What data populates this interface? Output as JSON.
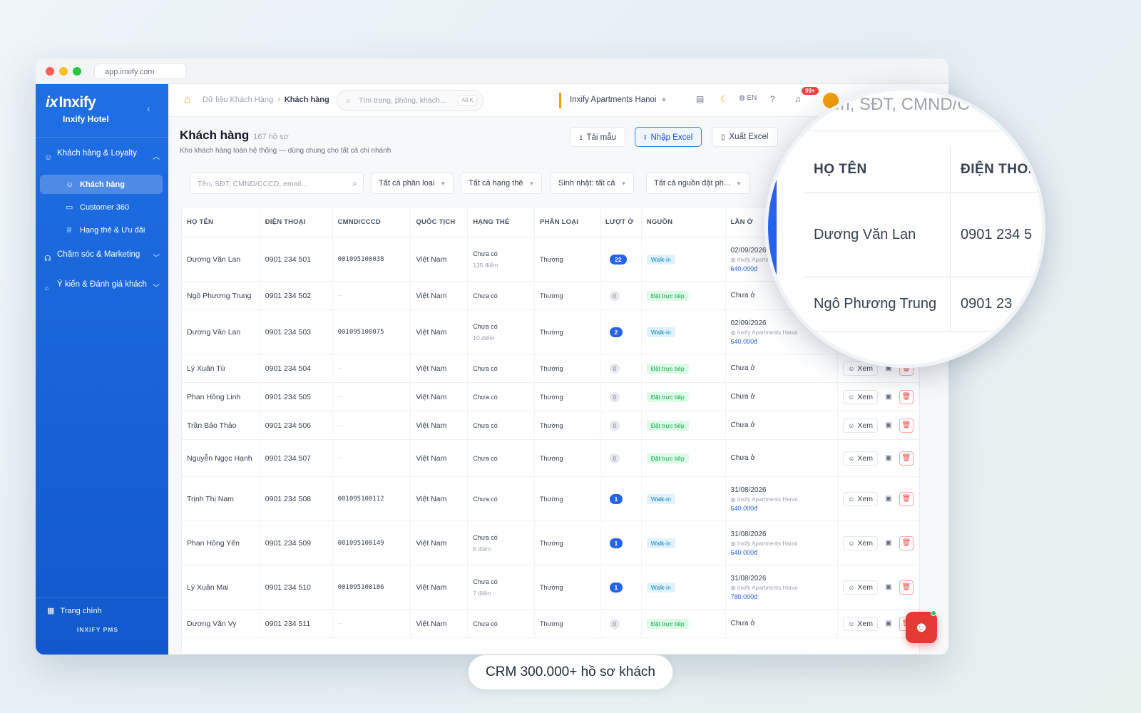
{
  "browser": {
    "url": "app.inxify.com"
  },
  "sidebar": {
    "logo": "Inxify",
    "logo_mark": "ix",
    "hotel": "Inxify Hotel",
    "groups": [
      {
        "label": "Khách hàng & Loyalty",
        "icon": "users-icon",
        "expanded": true
      },
      {
        "label": "Chăm sóc & Marketing",
        "icon": "headset-icon",
        "expanded": false
      },
      {
        "label": "Ý kiến & Đánh giá khách",
        "icon": "chat-icon",
        "expanded": false
      }
    ],
    "items": [
      {
        "label": "Khách hàng",
        "icon": "user-icon",
        "active": true
      },
      {
        "label": "Customer 360",
        "icon": "chart-icon",
        "active": false
      },
      {
        "label": "Hạng thẻ & Ưu đãi",
        "icon": "trophy-icon",
        "active": false
      }
    ],
    "home": "Trang chính",
    "footer": "INXIFY PMS"
  },
  "topbar": {
    "breadcrumb": [
      "Dữ liệu Khách Hàng",
      "Khách hàng"
    ],
    "search_placeholder": "Tìm trang, phòng, khách...",
    "search_shortcut": "Alt K",
    "branch": "Inxify Apartments Hanoi",
    "lang": "EN",
    "notifications": "99+"
  },
  "page": {
    "title": "Khách hàng",
    "count": "167 hồ sơ",
    "subtitle": "Kho khách hàng toàn hệ thống — dùng chung cho tất cả chi nhánh",
    "buttons": {
      "template": "Tải mẫu",
      "import": "Nhập Excel",
      "export": "Xuất Excel"
    }
  },
  "filters": {
    "search_placeholder": "Tên, SĐT, CMND/CCCD, email...",
    "classification": "Tất cả phân loại",
    "tier": "Tất cả hạng thẻ",
    "birthday": "Sinh nhật: tất cả",
    "source": "Tất cả nguồn đặt ph..."
  },
  "table": {
    "columns": [
      "HỌ TÊN",
      "ĐIỆN THOẠI",
      "CMND/CCCD",
      "QUỐC TỊCH",
      "HẠNG THẺ",
      "PHÂN LOẠI",
      "LƯỢT Ở",
      "NGUỒN",
      "LẦN Ở",
      ""
    ],
    "view_label": "Xem",
    "rows": [
      {
        "name": "Dương Văn Lan",
        "phone": "0901 234 501",
        "id": "001095100038",
        "nation": "Việt Nam",
        "tier": "Chưa có",
        "points": "135 điểm",
        "cls": "Thường",
        "stays": "22",
        "source": "Walk-in",
        "last_date": "02/09/2026",
        "last_hotel": "Inxify Apartments Hanoi",
        "last_price": "640.000đ"
      },
      {
        "name": "Ngô Phương Trung",
        "phone": "0901 234 502",
        "id": "—",
        "nation": "Việt Nam",
        "tier": "Chưa có",
        "points": "",
        "cls": "Thường",
        "stays": "0",
        "source": "Đặt trực tiếp",
        "last_date": "Chưa ở",
        "last_hotel": "",
        "last_price": ""
      },
      {
        "name": "Dương Văn Lan",
        "phone": "0901 234 503",
        "id": "001095100075",
        "nation": "Việt Nam",
        "tier": "Chưa có",
        "points": "10 điểm",
        "cls": "Thường",
        "stays": "2",
        "source": "Walk-in",
        "last_date": "02/09/2026",
        "last_hotel": "Inxify Apartments Hanoi",
        "last_price": "640.000đ"
      },
      {
        "name": "Lý Xuân Tú",
        "phone": "0901 234 504",
        "id": "—",
        "nation": "Việt Nam",
        "tier": "Chưa có",
        "points": "",
        "cls": "Thường",
        "stays": "0",
        "source": "Đặt trực tiếp",
        "last_date": "Chưa ở",
        "last_hotel": "",
        "last_price": ""
      },
      {
        "name": "Phan Hồng Linh",
        "phone": "0901 234 505",
        "id": "—",
        "nation": "Việt Nam",
        "tier": "Chưa có",
        "points": "",
        "cls": "Thường",
        "stays": "0",
        "source": "Đặt trực tiếp",
        "last_date": "Chưa ở",
        "last_hotel": "",
        "last_price": ""
      },
      {
        "name": "Trần Bảo Thảo",
        "phone": "0901 234 506",
        "id": "—",
        "nation": "Việt Nam",
        "tier": "Chưa có",
        "points": "",
        "cls": "Thường",
        "stays": "0",
        "source": "Đặt trực tiếp",
        "last_date": "Chưa ở",
        "last_hotel": "",
        "last_price": ""
      },
      {
        "name": "Nguyễn Ngọc Hạnh",
        "phone": "0901 234 507",
        "id": "—",
        "nation": "Việt Nam",
        "tier": "Chưa có",
        "points": "",
        "cls": "Thường",
        "stays": "0",
        "source": "Đặt trực tiếp",
        "last_date": "Chưa ở",
        "last_hotel": "",
        "last_price": ""
      },
      {
        "name": "Trịnh Thị Nam",
        "phone": "0901 234 508",
        "id": "001095100112",
        "nation": "Việt Nam",
        "tier": "Chưa có",
        "points": "",
        "cls": "Thường",
        "stays": "1",
        "source": "Walk-in",
        "last_date": "31/08/2026",
        "last_hotel": "Inxify Apartments Hanoi",
        "last_price": "640.000đ"
      },
      {
        "name": "Phan Hồng Yến",
        "phone": "0901 234 509",
        "id": "001095100149",
        "nation": "Việt Nam",
        "tier": "Chưa có",
        "points": "6 điểm",
        "cls": "Thường",
        "stays": "1",
        "source": "Walk-in",
        "last_date": "31/08/2026",
        "last_hotel": "Inxify Apartments Hanoi",
        "last_price": "640.000đ"
      },
      {
        "name": "Lý Xuân Mai",
        "phone": "0901 234 510",
        "id": "001095100186",
        "nation": "Việt Nam",
        "tier": "Chưa có",
        "points": "7 điểm",
        "cls": "Thường",
        "stays": "1",
        "source": "Walk-in",
        "last_date": "31/08/2026",
        "last_hotel": "Inxify Apartments Hanoi",
        "last_price": "780.000đ"
      },
      {
        "name": "Dương Văn Vy",
        "phone": "0901 234 511",
        "id": "—",
        "nation": "Việt Nam",
        "tier": "Chưa có",
        "points": "",
        "cls": "Thường",
        "stays": "0",
        "source": "Đặt trực tiếp",
        "last_date": "Chưa ở",
        "last_hotel": "",
        "last_price": ""
      }
    ]
  },
  "magnifier": {
    "search": "ên, SĐT, CMND/C",
    "col1": "HỌ TÊN",
    "col2": "ĐIỆN THO.",
    "rows": [
      {
        "name": "Dương Văn Lan",
        "phone": "0901 234 5"
      },
      {
        "name": "Ngô Phương Trung",
        "phone": "0901 23"
      }
    ]
  },
  "caption": "CRM 300.000+ hồ sơ khách",
  "colors": {
    "primary": "#1f6fe5",
    "accent": "#f59e0b",
    "danger": "#ef4444",
    "walkin": "#0284c7",
    "direct": "#16a34a"
  }
}
